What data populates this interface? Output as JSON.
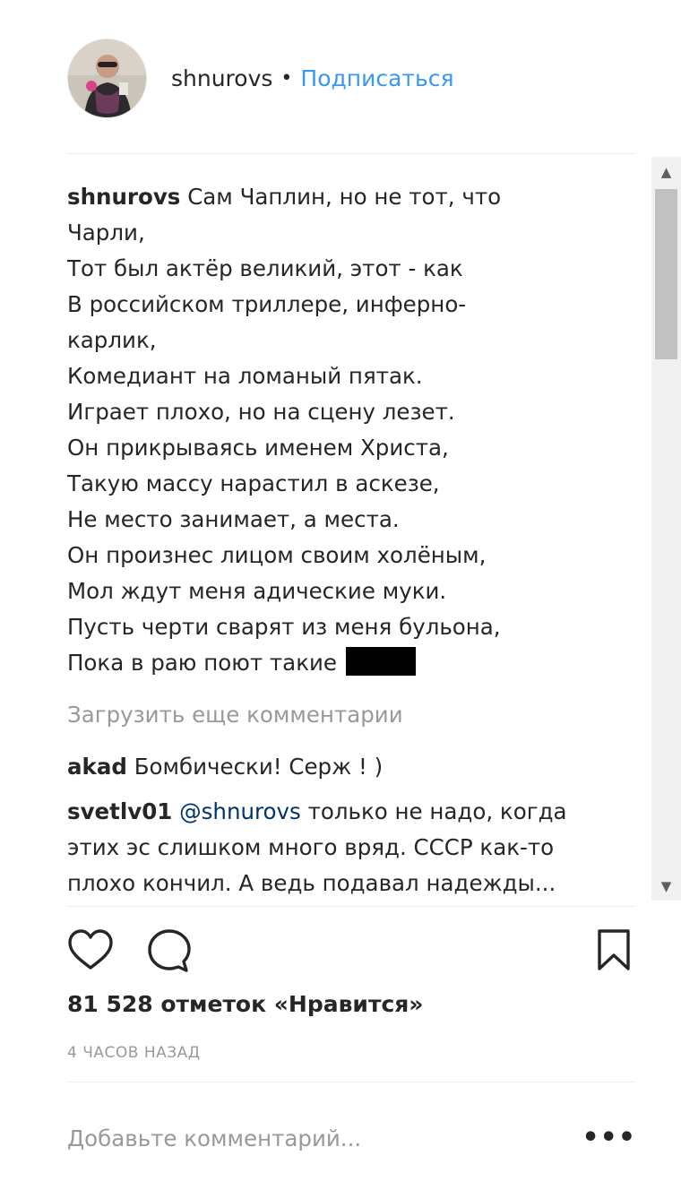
{
  "header": {
    "username": "shnurovs",
    "separator": "•",
    "follow_label": "Подписаться"
  },
  "caption": {
    "username": "shnurovs",
    "lines": [
      "Сам Чаплин, но не тот, что",
      "Чарли,",
      "Тот был актёр великий, этот - как",
      "В российском триллере, инферно-",
      "карлик,",
      "Комедиант на ломаный пятак.",
      "Играет плохо, но на сцену лезет.",
      "Он прикрываясь именем Христа,",
      "Такую массу нарастил в аскезе,",
      "Не место занимает, а места.",
      "Он произнес лицом своим холёным,",
      "Мол ждут меня адические муки.",
      "Пусть черти сварят из меня бульона,",
      "Пока в раю поют такие"
    ]
  },
  "load_more_label": "Загрузить еще комментарии",
  "comments": [
    {
      "username": "akad",
      "text": "Бомбически! Серж ! )"
    },
    {
      "username": "svetlv01",
      "mention": "@shnurovs",
      "text_line1": " только не надо, когда",
      "text_line2": "этих эс слишком много вряд. СССР как-то",
      "text_line3": "плохо кончил. А ведь подавал надежды..."
    }
  ],
  "likes_text": "81 528 отметок «Нравится»",
  "time_text": "4 ЧАСОВ НАЗАД",
  "add_comment": {
    "placeholder": "Добавьте комментарий..."
  },
  "more_label": "•••",
  "icons": {
    "like": "heart-icon",
    "comment": "comment-bubble-icon",
    "save": "bookmark-icon",
    "scroll_up": "▲",
    "scroll_down": "▼"
  },
  "colors": {
    "link": "#3897f0",
    "text": "#262626",
    "muted": "#999999",
    "mention": "#003569"
  }
}
